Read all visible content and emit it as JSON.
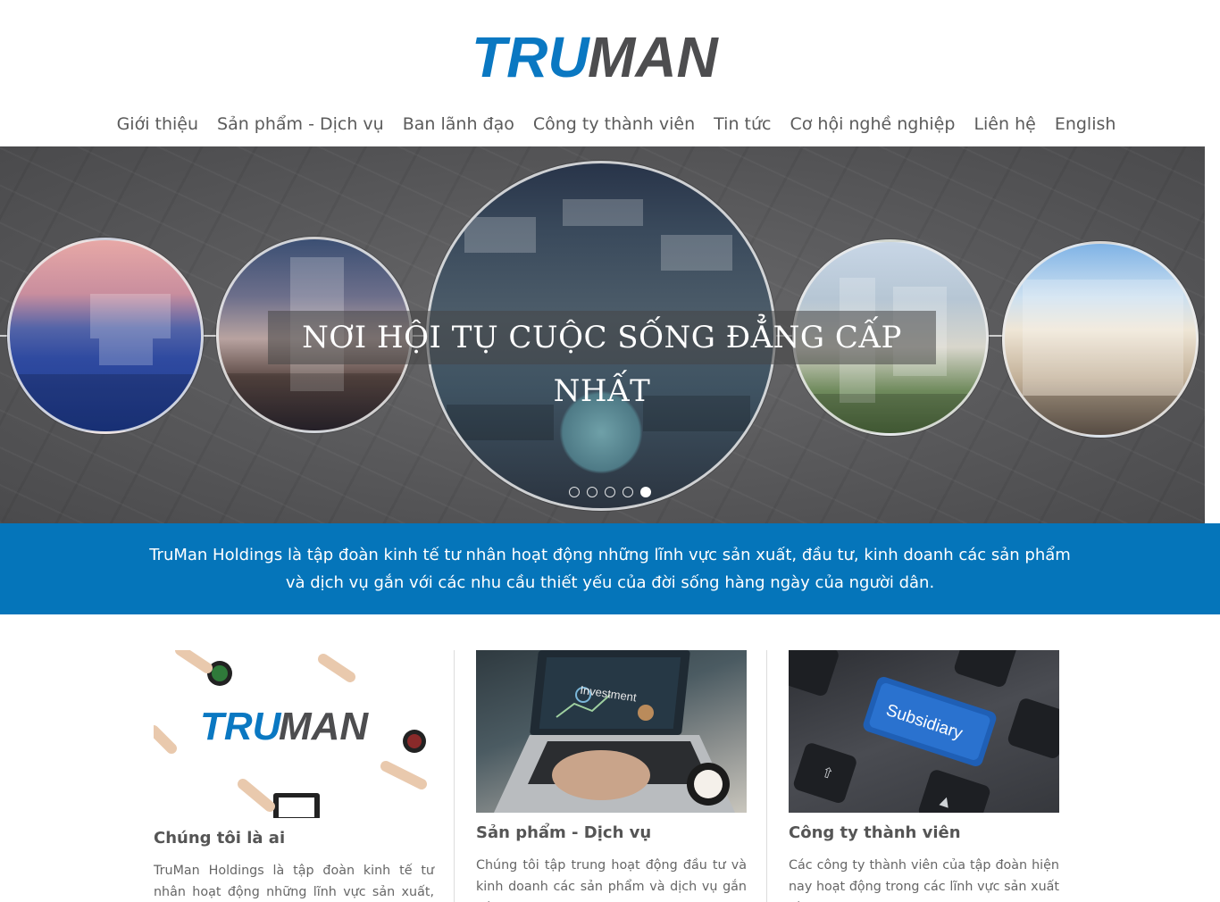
{
  "brand": {
    "logo_text_tru": "TRU",
    "logo_text_man": "MAN",
    "accent": "#0575ba",
    "gray": "#4d4d4f"
  },
  "nav": {
    "items": [
      "Giới thiệu",
      "Sản phẩm - Dịch vụ",
      "Ban lãnh đạo",
      "Công ty thành viên",
      "Tin tức",
      "Cơ hội nghề nghiệp",
      "Liên hệ",
      "English"
    ]
  },
  "hero": {
    "title": "NƠI HỘI TỤ CUỘC SỐNG ĐẲNG CẤP NHẤT",
    "slide_count": 5,
    "active_slide": 5
  },
  "band": {
    "line1": "TruMan Holdings là tập đoàn kinh tế tư nhân hoạt động những lĩnh vực sản xuất, đầu tư, kinh doanh các sản phẩm",
    "line2": "và dịch vụ gắn với các nhu cầu thiết yếu của đời sống hàng ngày của người dân."
  },
  "cards": [
    {
      "title": "Chúng tôi là ai",
      "text": "TruMan Holdings là tập đoàn kinh tế tư nhân hoạt động những lĩnh vực sản xuất, đầu tư,",
      "image_logo_tru": "TRU",
      "image_logo_man": "MAN"
    },
    {
      "title": "Sản phẩm - Dịch vụ",
      "text": "Chúng tôi tập trung hoạt động đầu tư và kinh doanh các sản phẩm và dịch vụ gắn với",
      "image_label": "Investment"
    },
    {
      "title": "Công ty thành viên",
      "text": "Các công ty thành viên của tập đoàn hiện nay hoạt động trong các lĩnh vực sản xuất và",
      "image_label": "Subsidiary"
    }
  ]
}
